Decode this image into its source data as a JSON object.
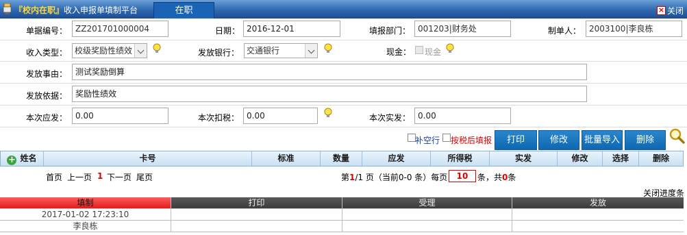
{
  "window": {
    "title_highlight": "『校内在职』",
    "title": "收入申报单填制平台",
    "active_tab": "在职",
    "close_label": "关闭"
  },
  "form": {
    "doc_no": {
      "label": "单据编号：",
      "value": "ZZ201701000004"
    },
    "date": {
      "label": "日期：",
      "value": "2016-12-01"
    },
    "dept": {
      "label": "填报部门：",
      "value": "001203|财务处"
    },
    "maker": {
      "label": "制单人：",
      "value": "2003100|李良栋"
    },
    "income_type": {
      "label": "收入类型：",
      "value": "校级奖励性绩效"
    },
    "bank": {
      "label": "发放银行：",
      "value": "交通银行"
    },
    "cash": {
      "label": "现金：",
      "checkbox_label": "现金"
    },
    "reason": {
      "label": "发放事由：",
      "value": "测试奖励倒算"
    },
    "basis": {
      "label": "发放依据：",
      "value": "奖励性绩效"
    },
    "payable": {
      "label": "本次应发：",
      "value": "0.00"
    },
    "tax": {
      "label": "本次扣税：",
      "value": "0.00"
    },
    "actual": {
      "label": "本次实发：",
      "value": "0.00"
    }
  },
  "options": {
    "fill_empty_row": "补空行",
    "fill_after_tax": "按税后填报"
  },
  "actions": {
    "print": "打印",
    "edit": "修改",
    "batch_import": "批量导入",
    "delete": "删除"
  },
  "grid": {
    "columns": [
      "姓名",
      "卡号",
      "标准",
      "数量",
      "应发",
      "所得税",
      "实发",
      "修改",
      "选择",
      "删除"
    ]
  },
  "pager": {
    "first": "首页",
    "prev": "上一页",
    "current": "1",
    "next": "下一页",
    "last": "尾页",
    "info_pre": "第",
    "page_cur": "1",
    "page_total_text": "/1 页（当前0-0 条）每页",
    "page_size": "10",
    "info_mid": "条，共",
    "total": "0",
    "info_post": "条"
  },
  "progress": {
    "close_label": "关闭进度条",
    "headers": [
      "填制",
      "打印",
      "受理",
      "发放"
    ],
    "row1": [
      "2017-01-02 17:23:10",
      "",
      "",
      ""
    ],
    "row2": [
      "李良栋",
      "",
      "",
      ""
    ]
  },
  "colors": {
    "titlebar": "#2f69b0",
    "button": "#1a78c2",
    "active_stage": "#e01b1b"
  }
}
